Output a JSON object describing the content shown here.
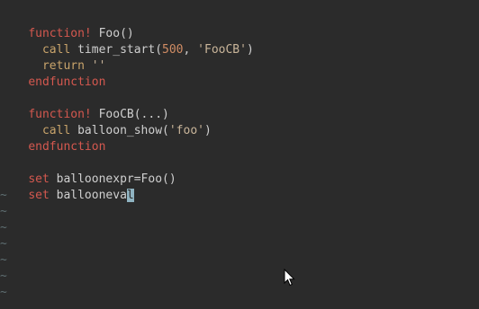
{
  "lines": [
    {
      "kw": "function!",
      "rest": " Foo()"
    },
    {
      "indent": "  ",
      "call": "call",
      "fn": " timer_start(",
      "num": "500",
      "sep": ", ",
      "str": "'FooCB'",
      "end": ")"
    },
    {
      "indent": "  ",
      "call": "return",
      "str": " ''"
    },
    {
      "kw": "endfunction"
    },
    {},
    {
      "kw": "function!",
      "rest": " FooCB(...)"
    },
    {
      "indent": "  ",
      "call": "call",
      "fn": " balloon_show(",
      "str": "'foo'",
      "end": ")"
    },
    {
      "kw": "endfunction"
    },
    {},
    {
      "kw": "set",
      "rest": " balloonexpr=Foo()"
    },
    {
      "kw": "set",
      "rest": " balloonev",
      "cursor": "a",
      "after": "l"
    }
  ],
  "tildes": [
    "~",
    "~",
    "~",
    "~",
    "~",
    "~",
    "~"
  ],
  "colors": {
    "background": "#2b2b2b",
    "keyword": "#d4584f",
    "string": "#c9b59a",
    "number": "#d08c64",
    "tilde": "#5f6f73",
    "cursor": "#8fb3c1"
  },
  "icons": {
    "mouse_pointer": "arrow-pointer-icon"
  }
}
